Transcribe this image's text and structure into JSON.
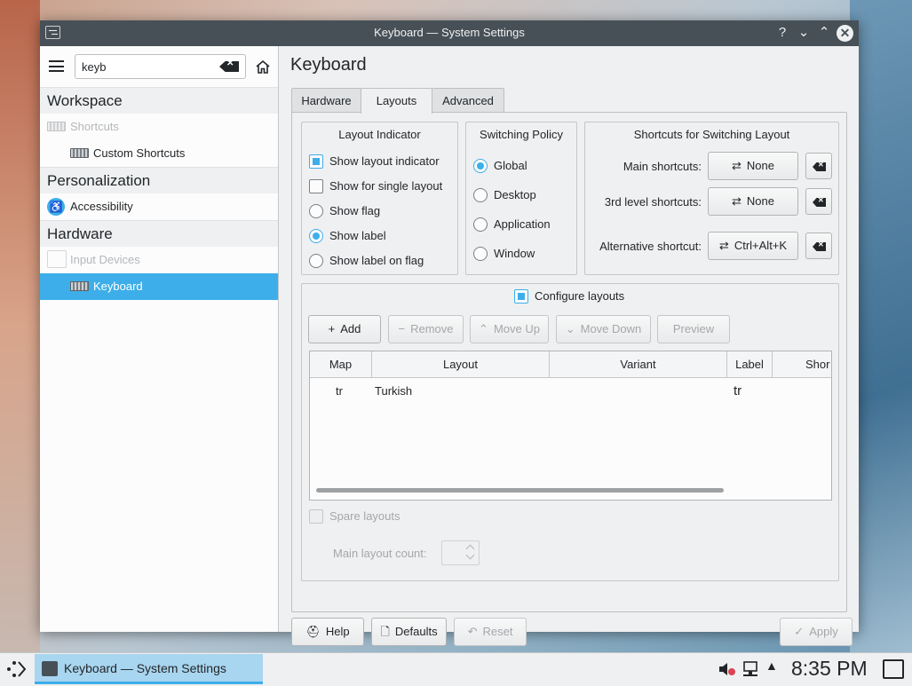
{
  "window": {
    "title": "Keyboard — System Settings"
  },
  "titlebar_buttons": {
    "help": "?",
    "minimize": "⌄",
    "maximize": "⌃",
    "close": "✕"
  },
  "sidebar": {
    "search_value": "keyb",
    "sections": [
      {
        "title": "Workspace"
      },
      {
        "title": "Personalization"
      },
      {
        "title": "Hardware"
      }
    ],
    "items": {
      "shortcuts": "Shortcuts",
      "custom_shortcuts": "Custom Shortcuts",
      "accessibility": "Accessibility",
      "input_devices": "Input Devices",
      "keyboard": "Keyboard"
    }
  },
  "main": {
    "title": "Keyboard",
    "tabs": [
      "Hardware",
      "Layouts",
      "Advanced"
    ],
    "layout_indicator": {
      "title": "Layout Indicator",
      "options": [
        "Show layout indicator",
        "Show for single layout",
        "Show flag",
        "Show label",
        "Show label on flag"
      ]
    },
    "switching_policy": {
      "title": "Switching Policy",
      "options": [
        "Global",
        "Desktop",
        "Application",
        "Window"
      ]
    },
    "shortcuts": {
      "title": "Shortcuts for Switching Layout",
      "main_label": "Main shortcuts:",
      "main_value": "None",
      "third_label": "3rd level shortcuts:",
      "third_value": "None",
      "alt_label": "Alternative shortcut:",
      "alt_value": "Ctrl+Alt+K"
    },
    "configure": {
      "label": "Configure layouts",
      "buttons": {
        "add": "Add",
        "remove": "Remove",
        "move_up": "Move Up",
        "move_down": "Move Down",
        "preview": "Preview"
      },
      "columns": [
        "Map",
        "Layout",
        "Variant",
        "Label",
        "Shor"
      ],
      "rows": [
        {
          "map": "tr",
          "layout": "Turkish",
          "variant": "",
          "label": "tr"
        }
      ],
      "spare_layouts": "Spare layouts",
      "main_layout_count": "Main layout count:"
    },
    "footer": {
      "help": "Help",
      "defaults": "Defaults",
      "reset": "Reset",
      "apply": "Apply"
    }
  },
  "taskbar": {
    "task_title": "Keyboard",
    "task_subtitle": "— System Settings",
    "clock": "8:35 PM"
  },
  "colors": {
    "accent": "#3daee9",
    "titlebar": "#475057",
    "window_bg": "#eff0f1"
  }
}
